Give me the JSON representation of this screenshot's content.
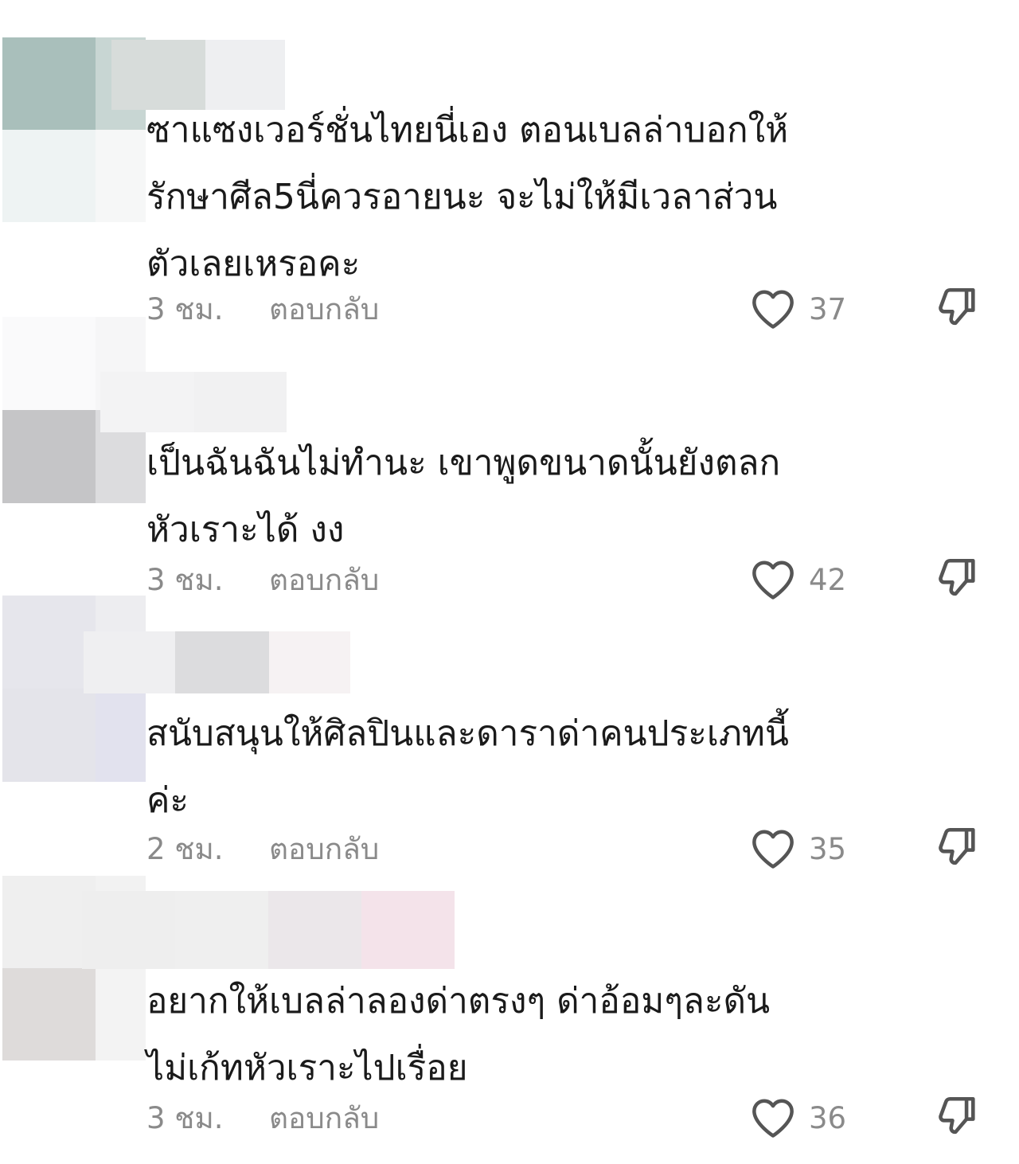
{
  "comments": [
    {
      "text": "ซาแซงเวอร์ชั่นไทยนี่เอง ตอนเบลล่าบอกให้\nรักษาศีล5นี่ควรอายนะ จะไม่ให้มีเวลาส่วน\nตัวเลยเหรอคะ",
      "time": "3 ชม.",
      "reply_label": "ตอบกลับ",
      "likes": "37"
    },
    {
      "text": "เป็นฉันฉันไม่ทำนะ เขาพูดขนาดนั้นยังตลก\nหัวเราะได้ งง",
      "time": "3 ชม.",
      "reply_label": "ตอบกลับ",
      "likes": "42"
    },
    {
      "text": "สนับสนุนให้ศิลปินและดาราด่าคนประเภทนี้\nค่ะ",
      "time": "2 ชม.",
      "reply_label": "ตอบกลับ",
      "likes": "35"
    },
    {
      "text": "อยากให้เบลล่าลองด่าตรงๆ ด่าอ้อมๆละดัน\nไม่เก้ทหัวเราะไปเรื่อย",
      "time": "3 ชม.",
      "reply_label": "ตอบกลับ",
      "likes": "36"
    }
  ],
  "icons": {
    "like": "heart-outline-icon",
    "dislike": "thumbs-down-outline-icon"
  },
  "colors": {
    "text": "#1a1a1a",
    "meta": "#8a8a8a",
    "icon": "#555555"
  }
}
